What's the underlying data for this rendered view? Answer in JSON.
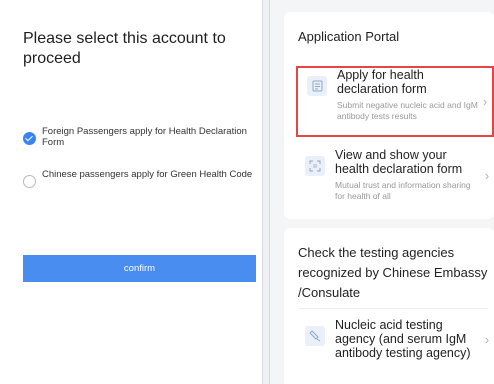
{
  "left": {
    "title": "Please select this account to proceed",
    "options": [
      {
        "label": "Foreign Passengers apply for Health Declaration Form",
        "checked": true
      },
      {
        "label": "Chinese passengers apply for Green Health Code",
        "checked": false
      }
    ],
    "confirm_label": "confirm"
  },
  "right": {
    "portal_title": "Application Portal",
    "items": [
      {
        "title": "Apply for health declaration form",
        "subtitle": "Submit negative nucleic acid and IgM antibody tests results",
        "icon": "document-icon"
      },
      {
        "title": "View and show your health declaration form",
        "subtitle": "Mutual trust and information sharing for health of all",
        "icon": "scan-icon"
      }
    ],
    "agencies_title": "Check the testing agencies recognized by Chinese Embassy /Consulate",
    "agency_item": {
      "title": "Nucleic acid testing agency (and serum IgM antibody testing agency)",
      "icon": "test-tube-icon"
    }
  },
  "colors": {
    "accent": "#4a8df0",
    "highlight_border": "#e64545",
    "icon_bg": "#eaf0f9"
  }
}
